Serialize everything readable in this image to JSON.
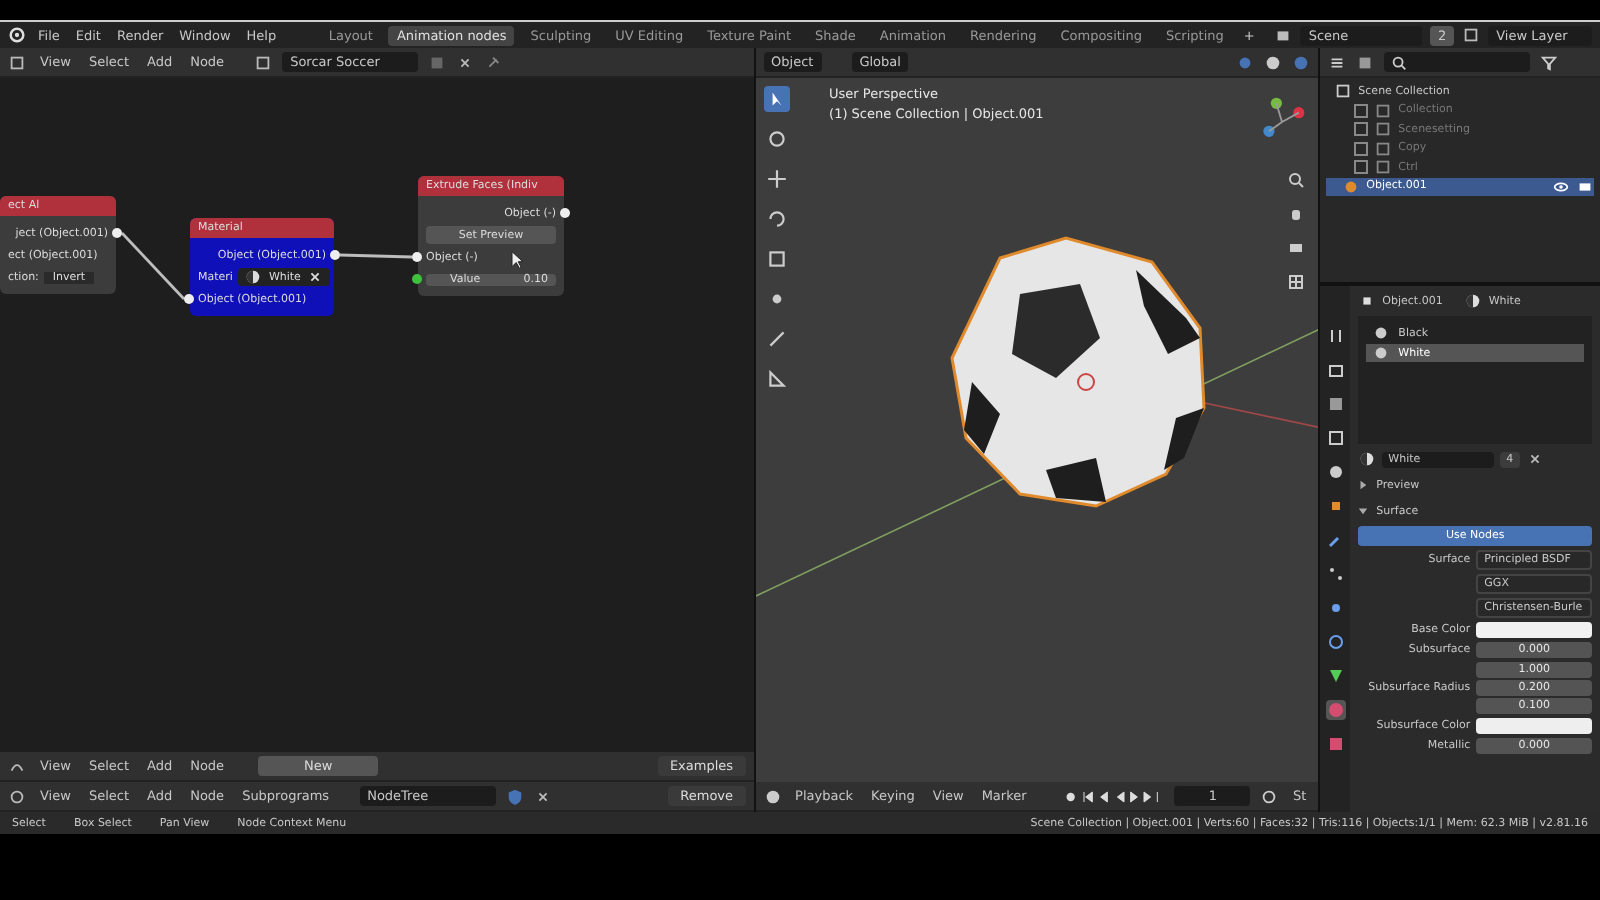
{
  "topbar": {
    "menus": [
      "File",
      "Edit",
      "Render",
      "Window",
      "Help"
    ],
    "workspaces": [
      {
        "label": "Layout",
        "selected": false
      },
      {
        "label": "Animation nodes",
        "selected": true
      },
      {
        "label": "Sculpting",
        "selected": false
      },
      {
        "label": "UV Editing",
        "selected": false
      },
      {
        "label": "Texture Paint",
        "selected": false
      },
      {
        "label": "Shade",
        "selected": false
      },
      {
        "label": "Animation",
        "selected": false
      },
      {
        "label": "Rendering",
        "selected": false
      },
      {
        "label": "Compositing",
        "selected": false
      },
      {
        "label": "Scripting",
        "selected": false
      }
    ],
    "add_tab": "+",
    "scene": "Scene",
    "layer_count": "2",
    "view_layer": "View Layer"
  },
  "node_editor": {
    "menus": [
      "View",
      "Select",
      "Add",
      "Node"
    ],
    "tree": "Sorcar Soccer",
    "nodes": [
      {
        "title": "ect Al",
        "kind": "plain",
        "rows": [
          {
            "kind": "output",
            "label": "ject (Object.001)"
          },
          {
            "kind": "text",
            "label": "ect (Object.001)"
          },
          {
            "kind": "dropdown",
            "label": "ction:",
            "value": "Invert"
          }
        ]
      },
      {
        "title": "Material",
        "kind": "selected",
        "rows": [
          {
            "kind": "output",
            "label": "Object (Object.001)"
          },
          {
            "kind": "material",
            "label": "Materi",
            "value": "White"
          },
          {
            "kind": "input",
            "label": "Object (Object.001)"
          }
        ]
      },
      {
        "title": "Extrude Faces (Indiv",
        "kind": "plain",
        "rows": [
          {
            "kind": "output",
            "label": "Object (-)"
          },
          {
            "kind": "button",
            "label": "Set Preview"
          },
          {
            "kind": "input",
            "label": "Object (-)"
          },
          {
            "kind": "value",
            "label": "Value",
            "value": "0.10"
          }
        ]
      }
    ]
  },
  "viewport": {
    "mode": "Object",
    "orientation": "Global",
    "view_name": "User Perspective",
    "context": "(1) Scene Collection | Object.001"
  },
  "outliner": {
    "root": "Scene Collection",
    "items": [
      {
        "label": "Collection",
        "selected": false,
        "excluded": true
      },
      {
        "label": "Scenesetting",
        "selected": false,
        "excluded": true
      },
      {
        "label": "Copy",
        "selected": false,
        "excluded": true
      },
      {
        "label": "Ctrl",
        "selected": false,
        "excluded": true
      },
      {
        "label": "Object.001",
        "selected": true,
        "excluded": false
      }
    ]
  },
  "properties": {
    "object": "Object.001",
    "material": "White",
    "slots": [
      {
        "label": "Black",
        "selected": false
      },
      {
        "label": "White",
        "selected": true
      }
    ],
    "material_field": "White",
    "users": "4",
    "panels": [
      {
        "label": "Preview",
        "expanded": false
      },
      {
        "label": "Surface",
        "expanded": true
      }
    ],
    "use_nodes": "Use Nodes",
    "settings": [
      {
        "kind": "dropdown",
        "label": "Surface",
        "value": "Principled BSDF"
      },
      {
        "kind": "dropdown",
        "value": "GGX"
      },
      {
        "kind": "dropdown",
        "value": "Christensen-Burle"
      },
      {
        "kind": "color",
        "label": "Base Color",
        "color": "#f2f2f2"
      },
      {
        "kind": "number",
        "label": "Subsurface",
        "value": "0.000"
      },
      {
        "kind": "vector",
        "label": "Subsurface Radius",
        "values": [
          "1.000",
          "0.200",
          "0.100"
        ]
      },
      {
        "kind": "color",
        "label": "Subsurface Color",
        "color": "#eeeeee"
      },
      {
        "kind": "number",
        "label": "Metallic",
        "value": "0.000"
      }
    ]
  },
  "node_footer": {
    "menus": [
      "View",
      "Select",
      "Add",
      "Node"
    ],
    "new": "New",
    "examples": "Examples"
  },
  "node_header2": {
    "menus": [
      "View",
      "Select",
      "Add",
      "Node",
      "Subprograms"
    ],
    "tree": "NodeTree",
    "remove": "Remove"
  },
  "timeline": {
    "menus": [
      "Playback",
      "Keying",
      "View",
      "Marker"
    ],
    "frame": "1",
    "start": "St"
  },
  "status": {
    "hints": [
      "Select",
      "Box Select",
      "Pan View",
      "Node Context Menu"
    ],
    "info": "Scene Collection | Object.001 | Verts:60 | Faces:32 | Tris:116 | Objects:1/1 | Mem: 62.3 MiB | v2.81.16"
  }
}
